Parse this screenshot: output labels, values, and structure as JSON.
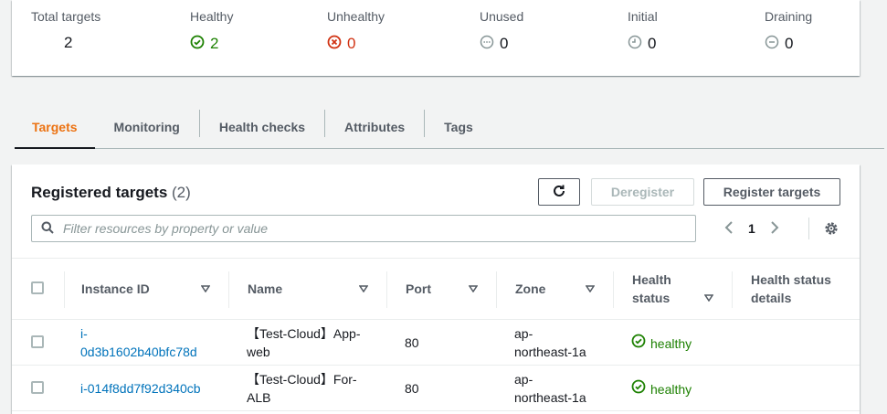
{
  "summary": {
    "total": {
      "label": "Total targets",
      "value": "2"
    },
    "healthy": {
      "label": "Healthy",
      "value": "2"
    },
    "unhealthy": {
      "label": "Unhealthy",
      "value": "0"
    },
    "unused": {
      "label": "Unused",
      "value": "0"
    },
    "initial": {
      "label": "Initial",
      "value": "0"
    },
    "draining": {
      "label": "Draining",
      "value": "0"
    }
  },
  "tabs": [
    "Targets",
    "Monitoring",
    "Health checks",
    "Attributes",
    "Tags"
  ],
  "registered": {
    "title": "Registered targets",
    "count": "(2)",
    "deregister": "Deregister",
    "register": "Register targets",
    "search_placeholder": "Filter resources by property or value",
    "page": "1"
  },
  "columns": {
    "instance_id": "Instance ID",
    "name": "Name",
    "port": "Port",
    "zone": "Zone",
    "health_l1": "Health",
    "health_l2": "status",
    "details_l1": "Health status",
    "details_l2": "details"
  },
  "rows": [
    {
      "id_l1": "i-",
      "id_l2": "0d3b1602b40bfc78d",
      "name_l1": "【Test-Cloud】App-",
      "name_l2": "web",
      "port": "80",
      "zone_l1": "ap-",
      "zone_l2": "northeast-1a",
      "status": "healthy"
    },
    {
      "id_l1": "i-014f8dd7f92d340cb",
      "id_l2": "",
      "name_l1": "【Test-Cloud】For-",
      "name_l2": "ALB",
      "port": "80",
      "zone_l1": "ap-",
      "zone_l2": "northeast-1a",
      "status": "healthy"
    }
  ],
  "colors": {
    "accent": "#ec7211",
    "link": "#0073bb",
    "success": "#1d8102",
    "error": "#d13212",
    "muted": "#879596"
  }
}
